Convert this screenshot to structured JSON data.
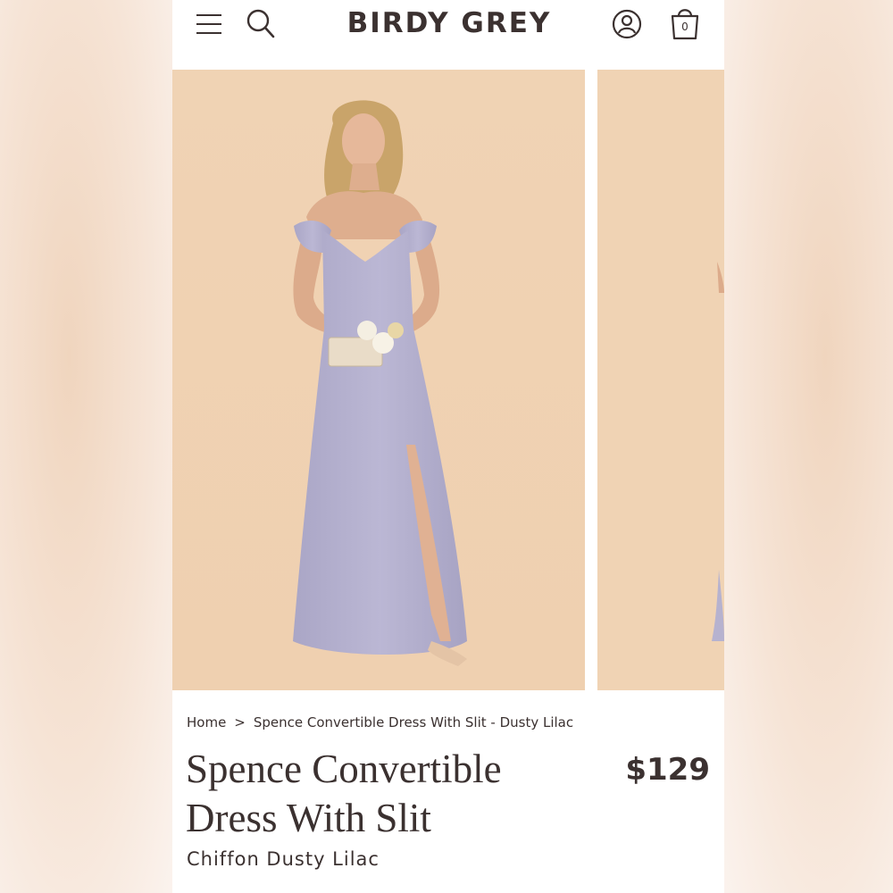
{
  "header": {
    "brand": "BIRDY GREY",
    "cart_count": "0",
    "icons": [
      "menu-icon",
      "search-icon",
      "account-icon",
      "cart-icon"
    ]
  },
  "gallery": {
    "background": "#f0d3b4",
    "dress_color": "#b6b2cf"
  },
  "breadcrumb": {
    "home": "Home",
    "separator": ">",
    "current": "Spence Convertible Dress With Slit - Dusty Lilac"
  },
  "product": {
    "title": "Spence Convertible Dress With Slit",
    "price": "$129",
    "subtitle": "Chiffon Dusty Lilac"
  },
  "colors": {
    "text": "#3b3130",
    "page_background": "#ffffff"
  }
}
